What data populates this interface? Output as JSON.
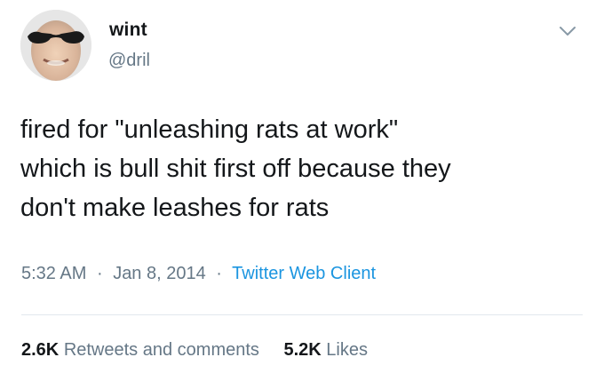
{
  "tweet": {
    "display_name": "wint",
    "handle": "@dril",
    "text": "fired for \"unleashing rats at work\"\nwhich is bull shit first off because they\ndon't make leashes for rats",
    "time": "5:32 AM",
    "separator": "·",
    "date": "Jan 8, 2014",
    "client": "Twitter Web Client",
    "retweets_count": "2.6K",
    "retweets_label": "Retweets and comments",
    "likes_count": "5.2K",
    "likes_label": "Likes"
  },
  "icons": {
    "menu": "chevron-down-icon"
  },
  "colors": {
    "text": "#14171a",
    "secondary": "#657786",
    "link": "#1b95e0",
    "divider": "#e1e8ed"
  }
}
